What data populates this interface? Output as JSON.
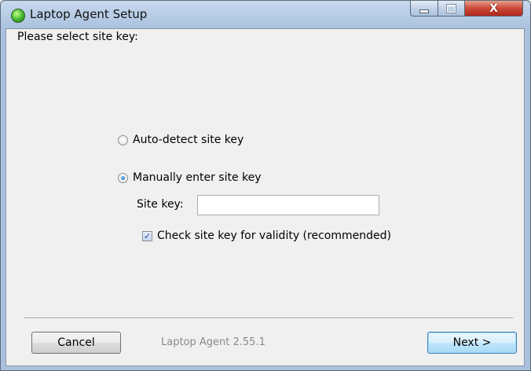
{
  "window": {
    "title": "Laptop Agent Setup",
    "close_glyph": "X"
  },
  "main": {
    "prompt": "Please select site key:",
    "options": [
      {
        "label": "Auto-detect site key",
        "selected": false
      },
      {
        "label": "Manually enter site key",
        "selected": true
      }
    ],
    "site_key": {
      "label": "Site key:",
      "value": "",
      "placeholder": ""
    },
    "validity_check": {
      "label": "Check site key for validity (recommended)",
      "checked": true,
      "glyph": "✓"
    }
  },
  "footer": {
    "cancel_label": "Cancel",
    "version": "Laptop Agent 2.55.1",
    "next_label": "Next >"
  }
}
